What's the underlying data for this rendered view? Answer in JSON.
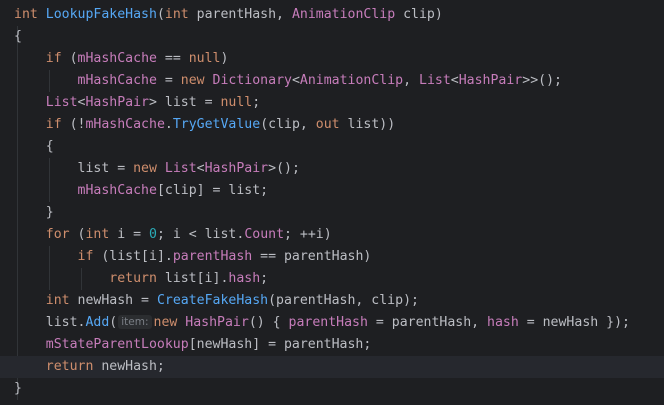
{
  "editor": {
    "language": "C#",
    "current_line": 17,
    "lines": [
      [
        {
          "t": "int",
          "c": "kw"
        },
        {
          "t": " ",
          "c": "tx"
        },
        {
          "t": "LookupFakeHash",
          "c": "fn"
        },
        {
          "t": "(",
          "c": "tx"
        },
        {
          "t": "int",
          "c": "kw"
        },
        {
          "t": " parentHash, ",
          "c": "tx"
        },
        {
          "t": "AnimationClip",
          "c": "ty"
        },
        {
          "t": " clip)",
          "c": "tx"
        }
      ],
      [
        {
          "t": "{",
          "c": "tx"
        }
      ],
      [
        {
          "t": "    ",
          "c": "tx"
        },
        {
          "t": "if",
          "c": "kw"
        },
        {
          "t": " (",
          "c": "tx"
        },
        {
          "t": "mHashCache",
          "c": "field"
        },
        {
          "t": " == ",
          "c": "tx"
        },
        {
          "t": "null",
          "c": "kw"
        },
        {
          "t": ")",
          "c": "tx"
        }
      ],
      [
        {
          "t": "        ",
          "c": "tx"
        },
        {
          "t": "mHashCache",
          "c": "field"
        },
        {
          "t": " = ",
          "c": "tx"
        },
        {
          "t": "new",
          "c": "kw"
        },
        {
          "t": " ",
          "c": "tx"
        },
        {
          "t": "Dictionary",
          "c": "ty"
        },
        {
          "t": "<",
          "c": "tx"
        },
        {
          "t": "AnimationClip",
          "c": "ty"
        },
        {
          "t": ", ",
          "c": "tx"
        },
        {
          "t": "List",
          "c": "ty"
        },
        {
          "t": "<",
          "c": "tx"
        },
        {
          "t": "HashPair",
          "c": "ty"
        },
        {
          "t": ">>();",
          "c": "tx"
        }
      ],
      [
        {
          "t": "    ",
          "c": "tx"
        },
        {
          "t": "List",
          "c": "ty"
        },
        {
          "t": "<",
          "c": "tx"
        },
        {
          "t": "HashPair",
          "c": "ty"
        },
        {
          "t": "> list = ",
          "c": "tx"
        },
        {
          "t": "null",
          "c": "kw"
        },
        {
          "t": ";",
          "c": "tx"
        }
      ],
      [
        {
          "t": "    ",
          "c": "tx"
        },
        {
          "t": "if",
          "c": "kw"
        },
        {
          "t": " (!",
          "c": "tx"
        },
        {
          "t": "mHashCache",
          "c": "field"
        },
        {
          "t": ".",
          "c": "tx"
        },
        {
          "t": "TryGetValue",
          "c": "fn"
        },
        {
          "t": "(clip, ",
          "c": "tx"
        },
        {
          "t": "out",
          "c": "kw"
        },
        {
          "t": " list))",
          "c": "tx"
        }
      ],
      [
        {
          "t": "    {",
          "c": "tx"
        }
      ],
      [
        {
          "t": "        list = ",
          "c": "tx"
        },
        {
          "t": "new",
          "c": "kw"
        },
        {
          "t": " ",
          "c": "tx"
        },
        {
          "t": "List",
          "c": "ty"
        },
        {
          "t": "<",
          "c": "tx"
        },
        {
          "t": "HashPair",
          "c": "ty"
        },
        {
          "t": ">();",
          "c": "tx"
        }
      ],
      [
        {
          "t": "        ",
          "c": "tx"
        },
        {
          "t": "mHashCache",
          "c": "field"
        },
        {
          "t": "[clip] = list;",
          "c": "tx"
        }
      ],
      [
        {
          "t": "    }",
          "c": "tx"
        }
      ],
      [
        {
          "t": "    ",
          "c": "tx"
        },
        {
          "t": "for",
          "c": "kw"
        },
        {
          "t": " (",
          "c": "tx"
        },
        {
          "t": "int",
          "c": "kw"
        },
        {
          "t": " i = ",
          "c": "tx"
        },
        {
          "t": "0",
          "c": "num"
        },
        {
          "t": "; i < list.",
          "c": "tx"
        },
        {
          "t": "Count",
          "c": "field"
        },
        {
          "t": "; ++i)",
          "c": "tx"
        }
      ],
      [
        {
          "t": "        ",
          "c": "tx"
        },
        {
          "t": "if",
          "c": "kw"
        },
        {
          "t": " (list[i].",
          "c": "tx"
        },
        {
          "t": "parentHash",
          "c": "field"
        },
        {
          "t": " == parentHash)",
          "c": "tx"
        }
      ],
      [
        {
          "t": "            ",
          "c": "tx"
        },
        {
          "t": "return",
          "c": "kw"
        },
        {
          "t": " list[i].",
          "c": "tx"
        },
        {
          "t": "hash",
          "c": "field"
        },
        {
          "t": ";",
          "c": "tx"
        }
      ],
      [
        {
          "t": "    ",
          "c": "tx"
        },
        {
          "t": "int",
          "c": "kw"
        },
        {
          "t": " newHash = ",
          "c": "tx"
        },
        {
          "t": "CreateFakeHash",
          "c": "fn"
        },
        {
          "t": "(parentHash, clip);",
          "c": "tx"
        }
      ],
      [
        {
          "t": "    list.",
          "c": "tx"
        },
        {
          "t": "Add",
          "c": "fn"
        },
        {
          "t": "(",
          "c": "tx"
        },
        {
          "t": "item:",
          "c": "hint"
        },
        {
          "t": "new",
          "c": "kw"
        },
        {
          "t": " ",
          "c": "tx"
        },
        {
          "t": "HashPair",
          "c": "ty"
        },
        {
          "t": "() { ",
          "c": "tx"
        },
        {
          "t": "parentHash",
          "c": "field"
        },
        {
          "t": " = parentHash, ",
          "c": "tx"
        },
        {
          "t": "hash",
          "c": "field"
        },
        {
          "t": " = newHash });",
          "c": "tx"
        }
      ],
      [
        {
          "t": "    ",
          "c": "tx"
        },
        {
          "t": "mStateParentLookup",
          "c": "field"
        },
        {
          "t": "[newHash] = parentHash;",
          "c": "tx"
        }
      ],
      [
        {
          "t": "    ",
          "c": "tx"
        },
        {
          "t": "return",
          "c": "kw"
        },
        {
          "t": " newHash;",
          "c": "tx"
        }
      ],
      [
        {
          "t": "}",
          "c": "tx"
        }
      ]
    ]
  },
  "colors": {
    "background": "#1e1f22",
    "current_line": "#26282e",
    "text": "#bcbec4",
    "keyword": "#cf8e6d",
    "function": "#56a8f5",
    "type_and_field": "#c77dbb",
    "number": "#2aacb8",
    "inlay_hint": "#7a7e85"
  }
}
